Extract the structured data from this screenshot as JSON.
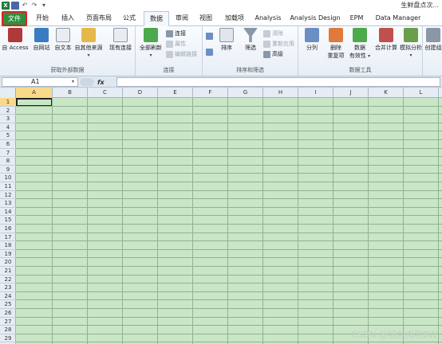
{
  "window": {
    "title": "生鲜盘点次..."
  },
  "quick_access": {
    "app_icon": "excel-icon",
    "save_icon": "save-icon",
    "undo_icon": "undo-icon",
    "redo_icon": "redo-icon",
    "more_icon": "customize-icon"
  },
  "tabs": [
    "文件",
    "开始",
    "插入",
    "页面布局",
    "公式",
    "数据",
    "审阅",
    "视图",
    "加载项",
    "Analysis",
    "Analysis Design",
    "EPM",
    "Data Manager"
  ],
  "active_tab": "数据",
  "ribbon": {
    "groups": {
      "external": {
        "label": "获取外部数据",
        "access": "自 Access",
        "web": "自网站",
        "text": "自文本",
        "other": "自其他来源",
        "existing": "现有连接"
      },
      "connections": {
        "label": "连接",
        "refresh_all": "全部刷新",
        "connections": "连接",
        "properties": "属性",
        "edit_links": "编辑链接"
      },
      "sort_filter": {
        "label": "排序和筛选",
        "sort": "排序",
        "filter": "筛选",
        "clear": "清除",
        "reapply": "重新应用",
        "advanced": "高级"
      },
      "tools": {
        "label": "数据工具",
        "split": "分列",
        "remove_dup_1": "删除",
        "remove_dup_2": "重复项",
        "validation_1": "数据",
        "validation_2": "有效性",
        "consolidate": "合并计算",
        "what_if": "模拟分析"
      },
      "outline": {
        "create_group": "创建组"
      }
    }
  },
  "formula_bar": {
    "name_box": "A1",
    "fx_label": "fx",
    "formula": ""
  },
  "columns": [
    "A",
    "B",
    "C",
    "D",
    "E",
    "F",
    "G",
    "H",
    "I",
    "J",
    "K",
    "L"
  ],
  "rows": [
    "1",
    "2",
    "3",
    "4",
    "5",
    "6",
    "7",
    "8",
    "9",
    "10",
    "11",
    "12",
    "13",
    "14",
    "15",
    "16",
    "17",
    "18",
    "19",
    "20",
    "21",
    "22",
    "23",
    "24",
    "25",
    "26",
    "27",
    "28",
    "29"
  ],
  "selected_cell": "A1",
  "watermark": "CSDN @锅包肉和BW",
  "colors": {
    "file_tab": "#2f8f3d",
    "file_tab_highlight": "#e02020",
    "cell_fill": "#c9e7c7",
    "selection_header": "#f9d98a"
  }
}
